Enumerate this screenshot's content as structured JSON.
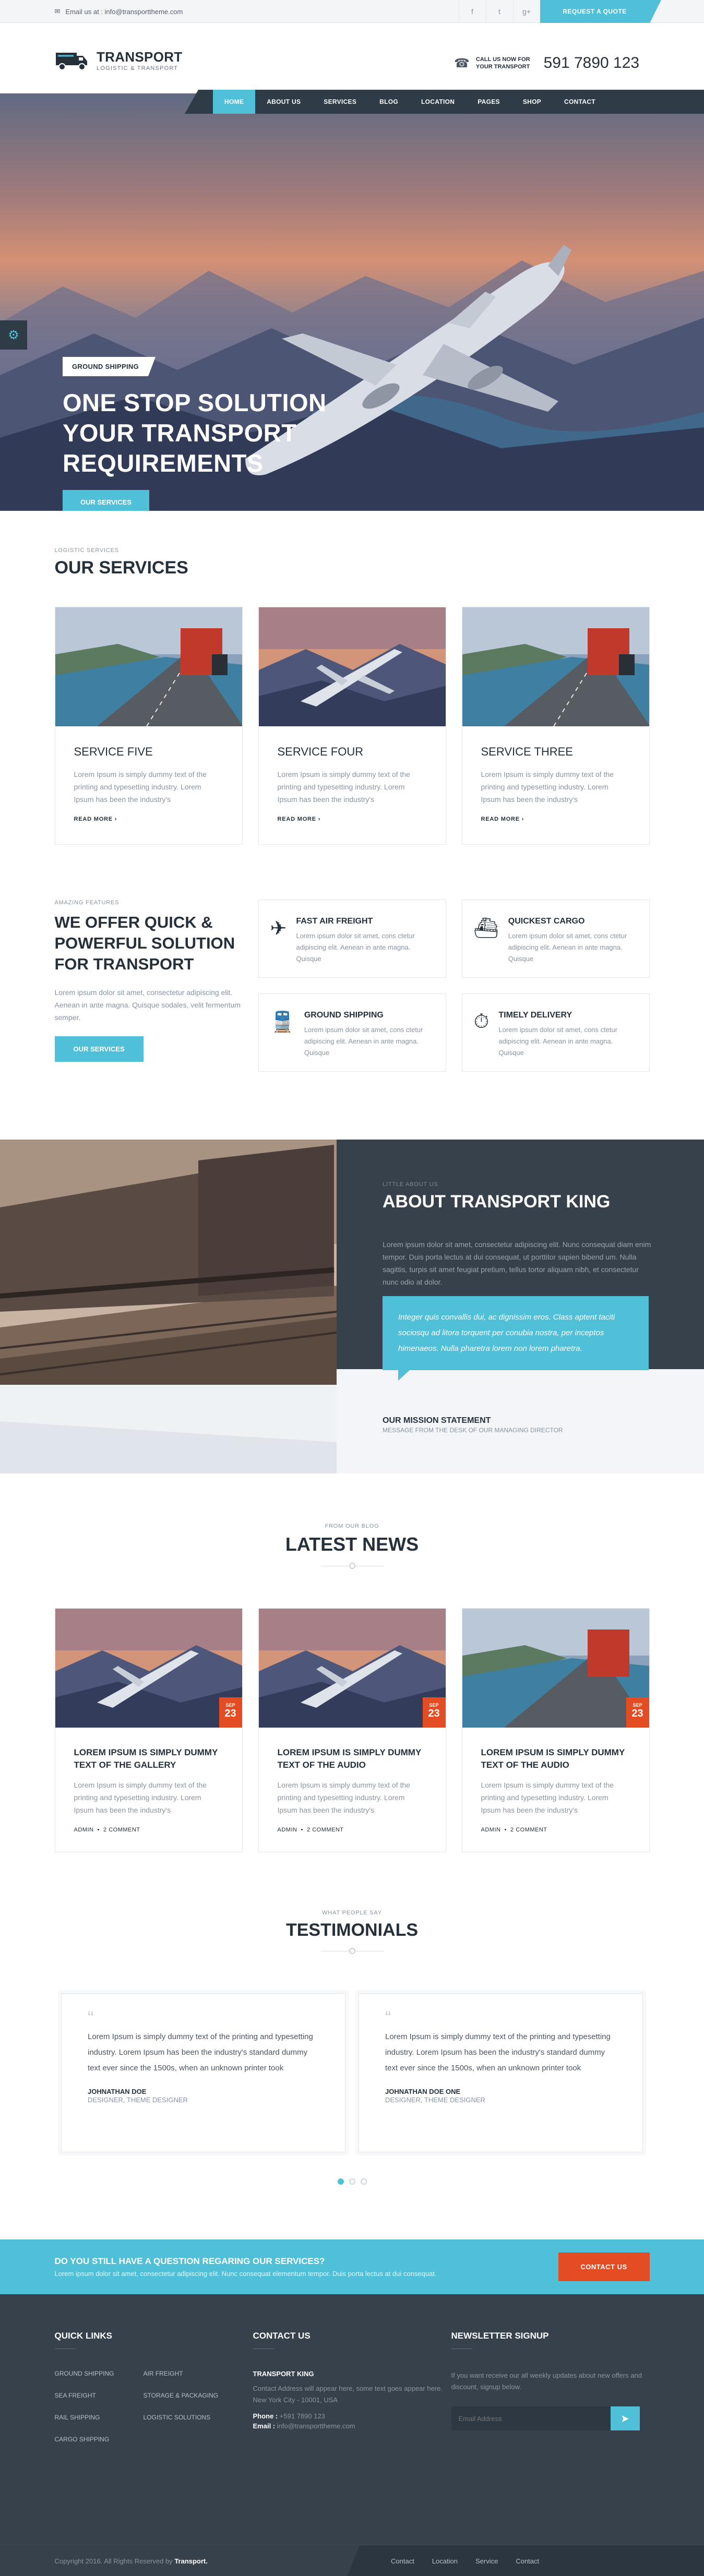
{
  "topbar": {
    "email": "Email us at : info@transporttheme.com",
    "social": [
      "f",
      "t",
      "g+"
    ],
    "quote_button": "REQUEST A QUOTE"
  },
  "brand": {
    "name": "TRANSPORT",
    "tagline": "LOGISTIC & TRANSPORT"
  },
  "call": {
    "label_line1": "CALL US NOW FOR",
    "label_line2": "YOUR TRANSPORT",
    "number": "591 7890 123"
  },
  "nav": [
    "HOME",
    "ABOUT US",
    "SERVICES",
    "BLOG",
    "LOCATION",
    "PAGES",
    "SHOP",
    "CONTACT"
  ],
  "hero": {
    "tag": "GROUND SHIPPING",
    "title_lines": [
      "ONE STOP SOLUTION",
      "YOUR TRANSPORT",
      "REQUIREMENTS"
    ],
    "button": "OUR SERVICES"
  },
  "services": {
    "small": "LOGISTIC SERVICES",
    "title": "OUR SERVICES",
    "cards": [
      {
        "title": "SERVICE FIVE",
        "text": "Lorem Ipsum is simply dummy text of the printing and typesetting industry. Lorem Ipsum has been the industry's",
        "more": "READ MORE"
      },
      {
        "title": "SERVICE FOUR",
        "text": "Lorem Ipsum is simply dummy text of the printing and typesetting industry. Lorem Ipsum has been the industry's",
        "more": "READ MORE"
      },
      {
        "title": "SERVICE THREE",
        "text": "Lorem Ipsum is simply dummy text of the printing and typesetting industry. Lorem Ipsum has been the industry's",
        "more": "READ MORE"
      }
    ]
  },
  "features": {
    "small": "AMAZING FEATURES",
    "title": "WE OFFER QUICK & POWERFUL SOLUTION FOR TRANSPORT",
    "text": "Lorem ipsum dolor sit amet, consectetur adipiscing elit. Aenean in ante magna. Quisque sodales, velit fermentum semper.",
    "button": "OUR SERVICES",
    "items": [
      {
        "icon": "plane-icon",
        "glyph": "✈",
        "title": "FAST AIR FREIGHT",
        "text": "Lorem ipsum dolor sit amet, cons ctetur adipiscing elit. Aenean in ante magna. Quisque"
      },
      {
        "icon": "ship-icon",
        "glyph": "⛴",
        "title": "QUICKEST CARGO",
        "text": "Lorem ipsum dolor sit amet, cons ctetur adipiscing elit. Aenean in ante magna. Quisque"
      },
      {
        "icon": "train-icon",
        "glyph": "🚆",
        "title": "GROUND SHIPPING",
        "text": "Lorem ipsum dolor sit amet, cons ctetur adipiscing elit. Aenean in ante magna. Quisque"
      },
      {
        "icon": "stopwatch-icon",
        "glyph": "⏱",
        "title": "TIMELY DELIVERY",
        "text": "Lorem ipsum dolor sit amet, cons ctetur adipiscing elit. Aenean in ante magna. Quisque"
      }
    ]
  },
  "about": {
    "small": "LITTLE ABOUT US",
    "title": "ABOUT TRANSPORT KING",
    "text": "Lorem ipsum dolor sit amet, consectetur adipiscing elit. Nunc consequat diam enim tempor. Duis porta lectus at dui consequat, ut porttitor sapien bibend um. Nulla sagittis, turpis sit amet feugiat pretium, tellus tortor aliquam nibh, et consectetur nunc odio at dolor.",
    "quote": "Integer quis convallis dui, ac dignissim eros. Class aptent taciti sociosqu ad litora torquent per conubia nostra, per inceptos himenaeos. Nulla pharetra lorem non lorem pharetra.",
    "mission_title": "OUR MISSION STATEMENT",
    "mission_sub": "MESSAGE FROM THE DESK OF OUR MANAGING DIRECTOR"
  },
  "news": {
    "small": "FROM OUR BLOG",
    "title": "LATEST NEWS",
    "posts": [
      {
        "month": "SEP",
        "day": "23",
        "title": "LOREM IPSUM IS SIMPLY DUMMY TEXT OF THE GALLERY",
        "text": "Lorem Ipsum is simply dummy text of the printing and typesetting industry. Lorem Ipsum has been the industry's",
        "author": "ADMIN",
        "comments": "2 COMMENT"
      },
      {
        "month": "SEP",
        "day": "23",
        "title": "LOREM IPSUM IS SIMPLY DUMMY TEXT OF THE AUDIO",
        "text": "Lorem Ipsum is simply dummy text of the printing and typesetting industry. Lorem Ipsum has been the industry's",
        "author": "ADMIN",
        "comments": "2 COMMENT"
      },
      {
        "month": "SEP",
        "day": "23",
        "title": "LOREM IPSUM IS SIMPLY DUMMY TEXT OF THE AUDIO",
        "text": "Lorem Ipsum is simply dummy text of the printing and typesetting industry. Lorem Ipsum has been the industry's",
        "author": "ADMIN",
        "comments": "2 COMMENT"
      }
    ]
  },
  "testimonials": {
    "small": "WHAT PEOPLE SAY",
    "title": "TESTIMONIALS",
    "items": [
      {
        "text": "Lorem Ipsum is simply dummy text of the printing and typesetting industry. Lorem Ipsum has been the industry's standard dummy text ever since the 1500s, when an unknown printer took",
        "name": "JOHNATHAN DOE",
        "role": "DESIGNER, THEME DESIGNER"
      },
      {
        "text": "Lorem Ipsum is simply dummy text of the printing and typesetting industry. Lorem Ipsum has been the industry's standard dummy text ever since the 1500s, when an unknown printer took",
        "name": "JOHNATHAN DOE ONE",
        "role": "DESIGNER, THEME DESIGNER"
      }
    ]
  },
  "question": {
    "title": "DO YOU STILL HAVE A QUESTION REGARING OUR SERVICES?",
    "text": "Lorem ipsum dolor sit amet, consectetur adipiscing elit. Nunc consequat elementum tempor. Duis porta lectus at dui consequat.",
    "button": "CONTACT US"
  },
  "footer": {
    "quick_title": "QUICK LINKS",
    "links": [
      "GROUND SHIPPING",
      "AIR FREIGHT",
      "SEA FREIGHT",
      "STORAGE & PACKAGING",
      "RAIL SHIPPING",
      "LOGISTIC SOLUTIONS",
      "CARGO SHIPPING"
    ],
    "contact_title": "CONTACT US",
    "company": "TRANSPORT KING",
    "address": "Contact Address will appear here, some text goes appear here. New York City - 10001, USA",
    "phone_label": "Phone :",
    "phone": "+591 7890 123",
    "email_label": "Email :",
    "email": "info@transporttheme.com",
    "news_title": "NEWSLETTER SIGNUP",
    "news_text": "If you want receive our all weekly updates about new offers and discount, signup below.",
    "email_placeholder": "Email Address",
    "copyright": "Copyright 2016. All Rights Reserved by",
    "copyright_brand": "Transport.",
    "bottom_links": [
      "Contact",
      "Location",
      "Service",
      "Contact"
    ]
  },
  "colors": {
    "accent": "#4fc0d8",
    "dark": "#36414c",
    "orange": "#e44c24"
  }
}
